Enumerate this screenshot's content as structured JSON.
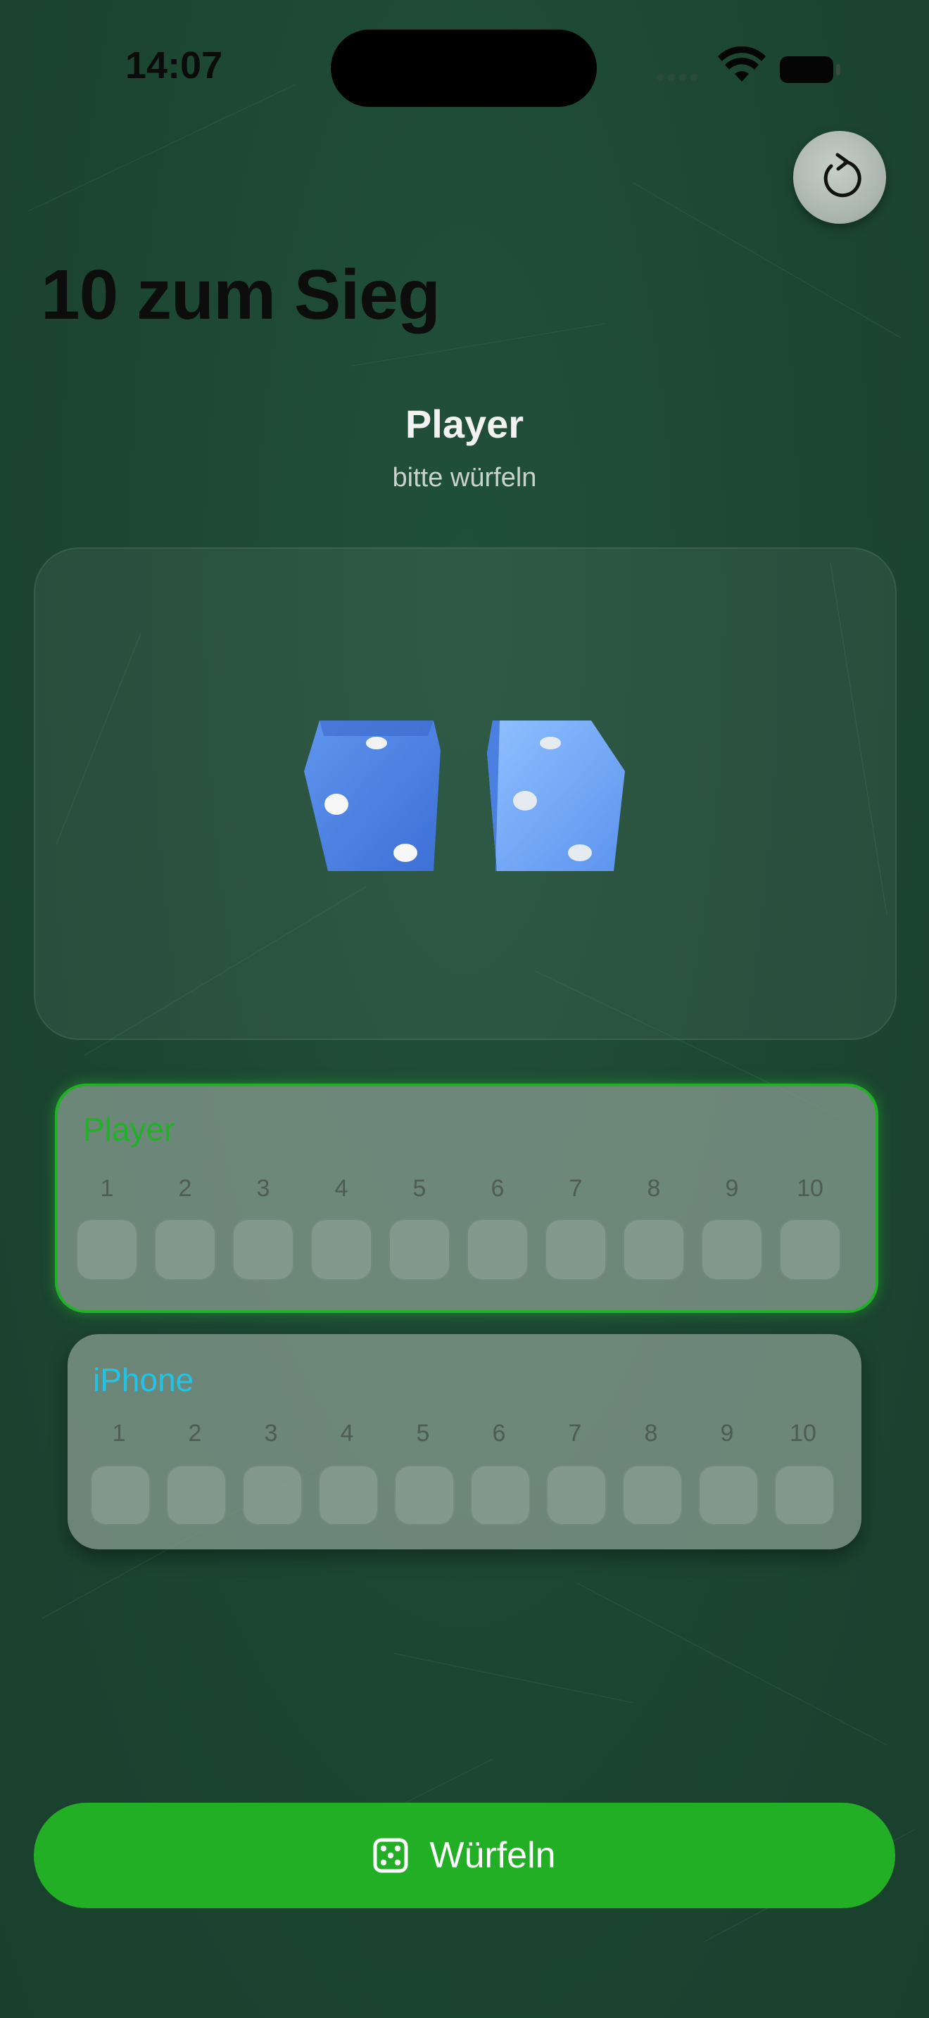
{
  "status_bar": {
    "time": "14:07"
  },
  "header": {
    "title": "10 zum Sieg",
    "reset_icon": "counterclockwise-arrow-icon"
  },
  "turn": {
    "player": "Player",
    "status": "bitte würfeln"
  },
  "dice": {
    "values": [
      3,
      3
    ],
    "color": "#4f86e8"
  },
  "players": [
    {
      "name": "Player",
      "color": "#22b028",
      "active": true,
      "numbers": [
        "1",
        "2",
        "3",
        "4",
        "5",
        "6",
        "7",
        "8",
        "9",
        "10"
      ]
    },
    {
      "name": "iPhone",
      "color": "#22c3e6",
      "active": false,
      "numbers": [
        "1",
        "2",
        "3",
        "4",
        "5",
        "6",
        "7",
        "8",
        "9",
        "10"
      ]
    }
  ],
  "roll_button": {
    "label": "Würfeln",
    "icon": "die-icon",
    "color": "#22ae25"
  }
}
